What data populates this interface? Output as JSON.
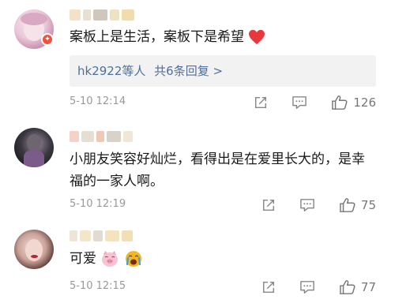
{
  "comments": [
    {
      "name": "",
      "text": "案板上是生活，案板下是希望",
      "reply_summary": {
        "users": "hk2922等人",
        "link": "共6条回复 >"
      },
      "time": "5-10 12:14",
      "likes": "126",
      "has_heart_emoji": true,
      "icons": {
        "share": "share-icon",
        "comment": "comment-icon",
        "like": "thumb-up-icon"
      }
    },
    {
      "name": "",
      "text": "小朋友笑容好灿烂，看得出是在爱里长大的，是幸福的一家人啊。",
      "time": "5-10 12:19",
      "likes": "75",
      "icons": {
        "share": "share-icon",
        "comment": "comment-icon",
        "like": "thumb-up-icon"
      }
    },
    {
      "name": "",
      "text": "可爱",
      "emojis": [
        "pig-emoji",
        "crying-face-emoji"
      ],
      "time": "5-10 12:15",
      "likes": "77",
      "icons": {
        "share": "share-icon",
        "comment": "comment-icon",
        "like": "thumb-up-icon"
      }
    }
  ],
  "colors": {
    "link": "#4f6f9c",
    "meta": "#999999",
    "heart": "#e8383d",
    "badge": "#f0503c"
  }
}
